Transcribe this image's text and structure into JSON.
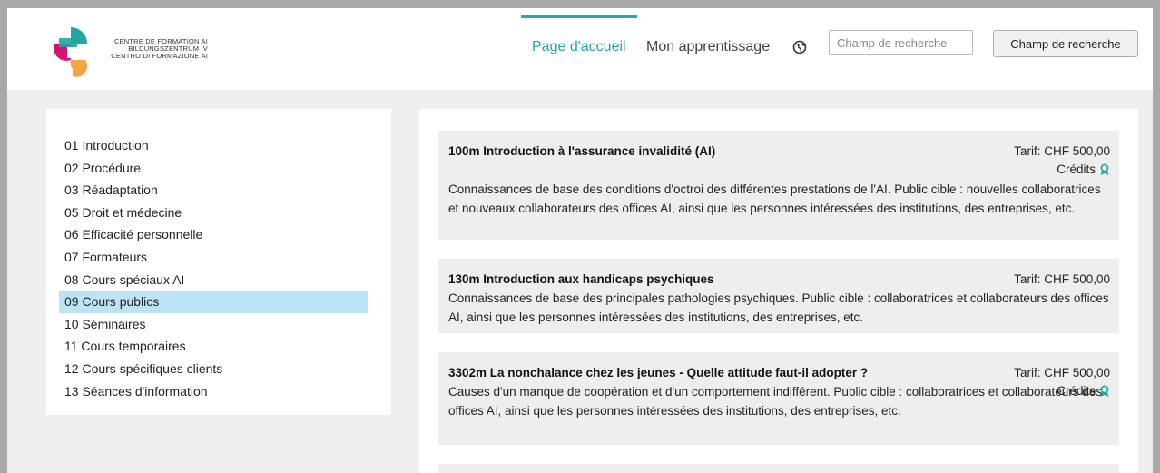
{
  "logo": {
    "lines": [
      "CENTRE DE FORMATION AI",
      "BILDUNGSZENTRUM IV",
      "CENTRO DI FORMAZIONE AI"
    ],
    "colors": {
      "teal": "#22a7a0",
      "magenta": "#d6136f",
      "orange": "#f2a541",
      "dark": "#333333"
    }
  },
  "nav": {
    "home": "Page d'accueil",
    "learning": "Mon apprentissage",
    "language_icon": "globe-icon",
    "accent": "#23a6a6"
  },
  "search": {
    "placeholder": "Champ de recherche",
    "button": "Champ de recherche"
  },
  "sidebar": {
    "active_index": 8,
    "active_color": "#bde4f6",
    "items": [
      "01 Introduction",
      "02 Procédure",
      "03 Réadaptation",
      "05 Droit et médecine",
      "06 Efficacité personnelle",
      "07 Formateurs",
      "08 Cours spéciaux AI",
      "09 Cours publics",
      "10 Séminaires",
      "11 Cours temporaires",
      "12 Cours spécifiques clients",
      "13 Séances d'information"
    ]
  },
  "courses": [
    {
      "title": "100m Introduction à l'assurance invalidité (AI)",
      "price": "Tarif: CHF 500,00",
      "credits": "Crédits",
      "description": "Connaissances de base des conditions d'octroi des différentes prestations de l'AI. Public cible : nouvelles collaboratrices et nouveaux collaborateurs des offices AI, ainsi que les personnes intéressées des institutions, des entreprises, etc."
    },
    {
      "title": "130m Introduction aux handicaps psychiques",
      "price": "Tarif: CHF 500,00",
      "description": "Connaissances de base des principales pathologies psychiques. Public cible : collaboratrices et collaborateurs des offices AI, ainsi que les personnes intéressées des institutions, des entreprises, etc."
    },
    {
      "title": "3302m La nonchalance chez les jeunes - Quelle attitude faut-il adopter ?",
      "price": "Tarif: CHF 500,00",
      "credits": "Crédits",
      "description": "Causes d'un manque de coopération et d'un comportement indifférent. Public cible : collaboratrices et collaborateurs des offices AI, ainsi que les personnes intéressées des institutions, des entreprises, etc."
    }
  ]
}
